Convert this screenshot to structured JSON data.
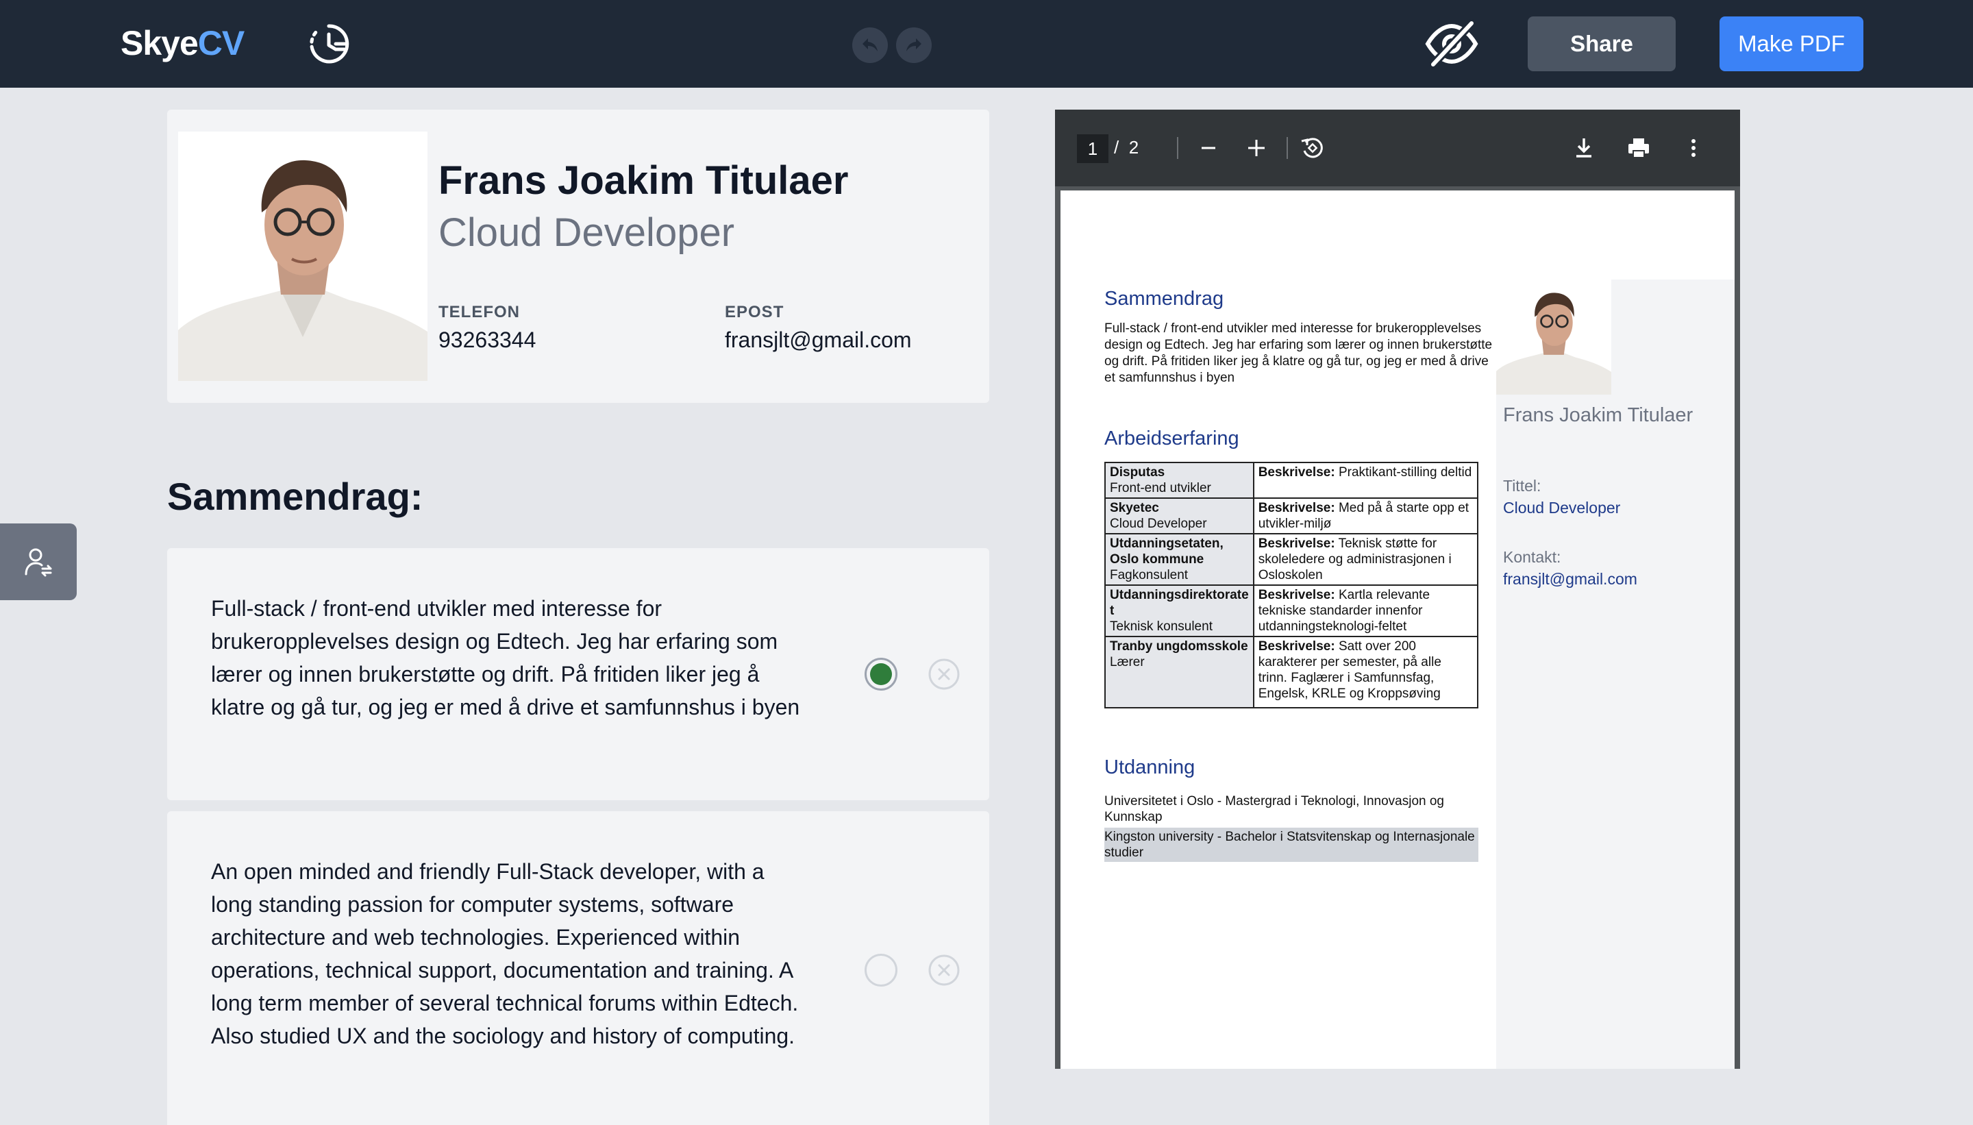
{
  "topbar": {
    "logo_main": "Skye",
    "logo_accent": "CV",
    "share_label": "Share",
    "make_pdf_label": "Make PDF"
  },
  "profile": {
    "name": "Frans Joakim Titulaer",
    "title": "Cloud Developer",
    "phone_label": "TELEFON",
    "phone": "93263344",
    "email_label": "EPOST",
    "email": "fransjlt@gmail.com"
  },
  "summary_section": {
    "title": "Sammendrag:",
    "items": [
      {
        "text": "Full-stack / front-end utvikler med interesse for brukeropplevelses design og Edtech. Jeg har erfaring som lærer og innen brukerstøtte og drift. På fritiden liker jeg å klatre og gå tur, og jeg er med å drive et samfunnshus i byen",
        "selected": true
      },
      {
        "text": "An open minded and friendly Full-Stack developer, with a long standing passion for computer systems, software architecture and web technologies. Experienced within operations, technical support, documentation and training. A long term member of several technical forums within Edtech. Also studied UX and the sociology and history of computing.",
        "selected": false
      }
    ]
  },
  "pdf_viewer": {
    "current_page": "1",
    "page_separator": "/",
    "total_pages": "2"
  },
  "pdf": {
    "summary_heading": "Sammendrag",
    "summary_text": "Full-stack / front-end utvikler med interesse for brukeropplevelses design og Edtech. Jeg har erfaring som lærer og innen brukerstøtte og drift. På fritiden liker jeg å klatre og gå tur, og jeg er med å drive et samfunnshus i byen",
    "experience_heading": "Arbeidserfaring",
    "description_label": "Beskrivelse:",
    "jobs": [
      {
        "company": "Disputas",
        "role": "Front-end utvikler",
        "description": "Praktikant-stilling deltid"
      },
      {
        "company": "Skyetec",
        "role": "Cloud Developer",
        "description": "Med på å starte opp et utvikler-miljø"
      },
      {
        "company": "Utdanningsetaten, Oslo kommune",
        "role": "Fagkonsulent",
        "description": "Teknisk støtte for skoleledere og administrasjonen i Osloskolen"
      },
      {
        "company": "Utdanningsdirektorate t",
        "role": "Teknisk konsulent",
        "description": "Kartla relevante tekniske standarder innenfor utdanningsteknologi-feltet"
      },
      {
        "company": "Tranby ungdomsskole",
        "role": "Lærer",
        "description": "Satt over 200 karakterer per semester, på alle trinn. Faglærer i Samfunnsfag, Engelsk, KRLE og Kroppsøving"
      }
    ],
    "education_heading": "Utdanning",
    "education": [
      "Universitetet i Oslo - Mastergrad i Teknologi, Innovasjon og Kunnskap",
      "Kingston university - Bachelor i Statsvitenskap og Internasjonale studier"
    ],
    "side_name": "Frans Joakim Titulaer",
    "side_title_label": "Tittel:",
    "side_title": "Cloud Developer",
    "side_contact_label": "Kontakt:",
    "side_contact": "fransjlt@gmail.com"
  },
  "colors": {
    "topbar_bg": "#1f2937",
    "logo_accent": "#60a5fa",
    "primary_button": "#3b82f6",
    "selected_radio": "#2f7d3b",
    "pdf_heading": "#1e3a8a"
  }
}
